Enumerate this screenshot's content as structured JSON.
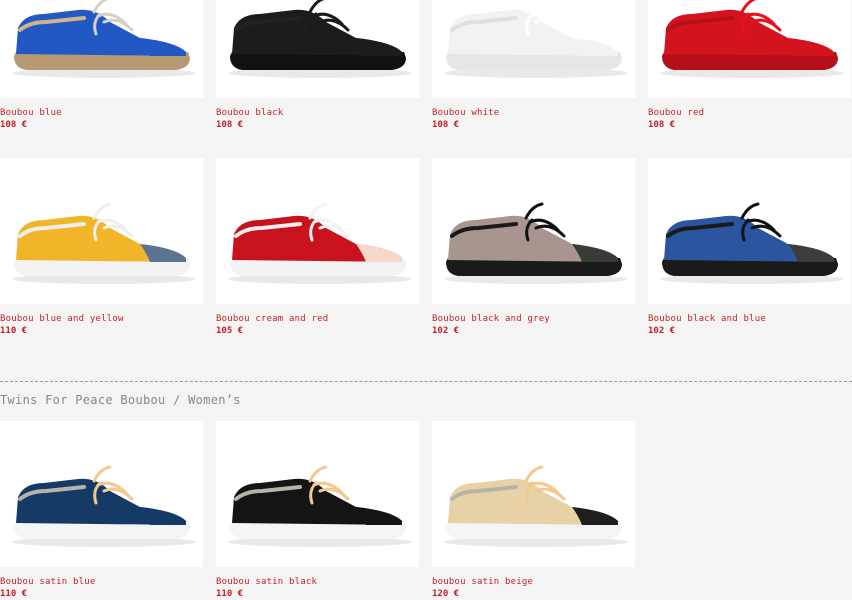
{
  "products_row1": [
    {
      "name": "Boubou blue",
      "price": "108 €",
      "upper": "#2158c4",
      "sole": "#b89a72",
      "toe": "#2158c4",
      "lace": "#d9d0c4",
      "foxing": "#d2b48c"
    },
    {
      "name": "Boubou black",
      "price": "108 €",
      "upper": "#1c1c1c",
      "sole": "#111111",
      "toe": "#1c1c1c",
      "lace": "#1a1a1a",
      "foxing": "#222222"
    },
    {
      "name": "Boubou white",
      "price": "108 €",
      "upper": "#f2f2f2",
      "sole": "#e6e6e6",
      "toe": "#f2f2f2",
      "lace": "#ffffff",
      "foxing": "#e0e0e0"
    },
    {
      "name": "Boubou red",
      "price": "108 €",
      "upper": "#d3141e",
      "sole": "#b5101a",
      "toe": "#d3141e",
      "lace": "#e8101e",
      "foxing": "#b5101a"
    }
  ],
  "products_row2": [
    {
      "name": "Boubou blue and yellow",
      "price": "110 €",
      "upper": "#f1b52a",
      "sole": "#f3f3f3",
      "toe": "#5a7391",
      "lace": "#eeeeee",
      "foxing": "#eeeeee"
    },
    {
      "name": "Boubou cream and red",
      "price": "105 €",
      "upper": "#c8121e",
      "sole": "#f3f3f3",
      "toe": "#f6d7c9",
      "lace": "#f3f3f3",
      "foxing": "#eeeeee"
    },
    {
      "name": "Boubou black and grey",
      "price": "102 €",
      "upper": "#a89590",
      "sole": "#1a1a1a",
      "toe": "#3a3a36",
      "lace": "#111111",
      "foxing": "#1a1a1a"
    },
    {
      "name": "Boubou black and blue",
      "price": "102 €",
      "upper": "#2c55a0",
      "sole": "#1a1a1a",
      "toe": "#3c3c38",
      "lace": "#111111",
      "foxing": "#1a1a1a"
    }
  ],
  "section": {
    "title": "Twins For Peace Boubou / Women’s"
  },
  "products_row3": [
    {
      "name": "Boubou satin blue",
      "price": "110 €",
      "upper": "#163a66",
      "sole": "#f5f5f5",
      "toe": "#163a66",
      "lace": "#f3c98e",
      "foxing": "#b9b2a8"
    },
    {
      "name": "Boubou satin black",
      "price": "110 €",
      "upper": "#141414",
      "sole": "#f5f5f5",
      "toe": "#141414",
      "lace": "#f3c98e",
      "foxing": "#b9b2a8"
    },
    {
      "name": "boubou satin beige",
      "price": "120 €",
      "upper": "#e6d2a6",
      "sole": "#f5f5f5",
      "toe": "#1e1e1e",
      "lace": "#f3c98e",
      "foxing": "#b9b2a8"
    }
  ]
}
